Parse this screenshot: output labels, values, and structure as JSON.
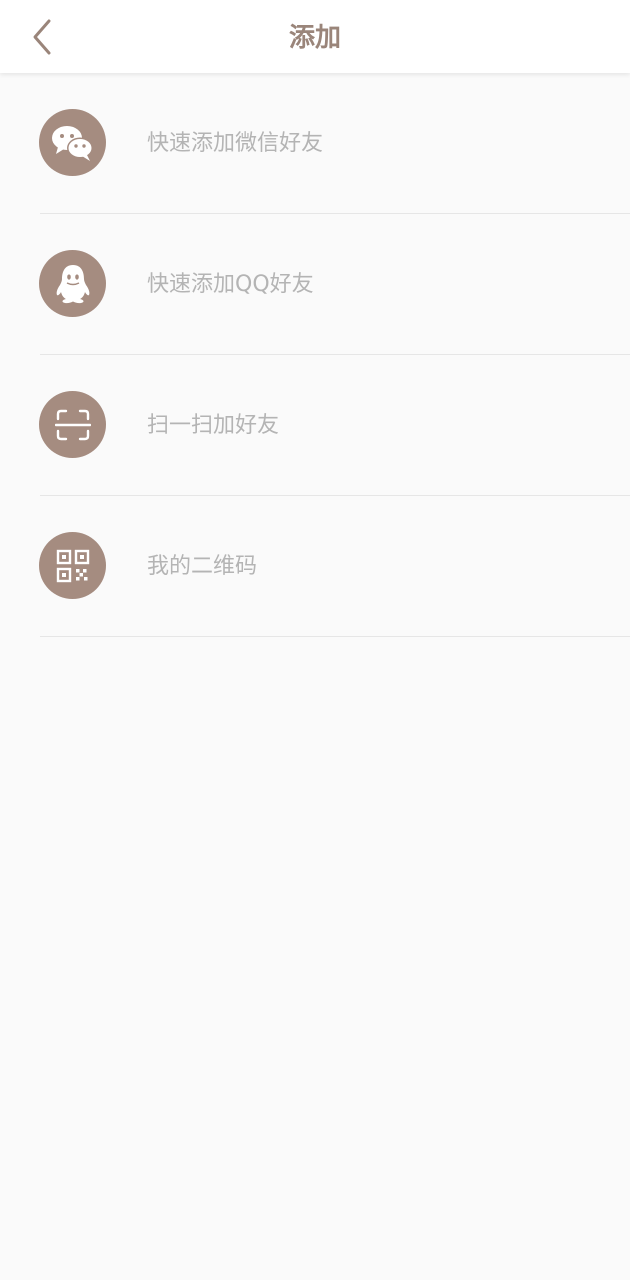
{
  "header": {
    "title": "添加",
    "back_icon": "chevron-left-icon"
  },
  "colors": {
    "accent": "#a58c80",
    "title": "#9a857a",
    "label": "#b4b4b4",
    "background": "#fafafa",
    "divider": "#e6e6e6"
  },
  "items": [
    {
      "label": "快速添加微信好友",
      "icon": "wechat-icon"
    },
    {
      "label": "快速添加QQ好友",
      "icon": "qq-icon"
    },
    {
      "label": "扫一扫加好友",
      "icon": "scan-icon"
    },
    {
      "label": "我的二维码",
      "icon": "qr-code-icon"
    }
  ]
}
